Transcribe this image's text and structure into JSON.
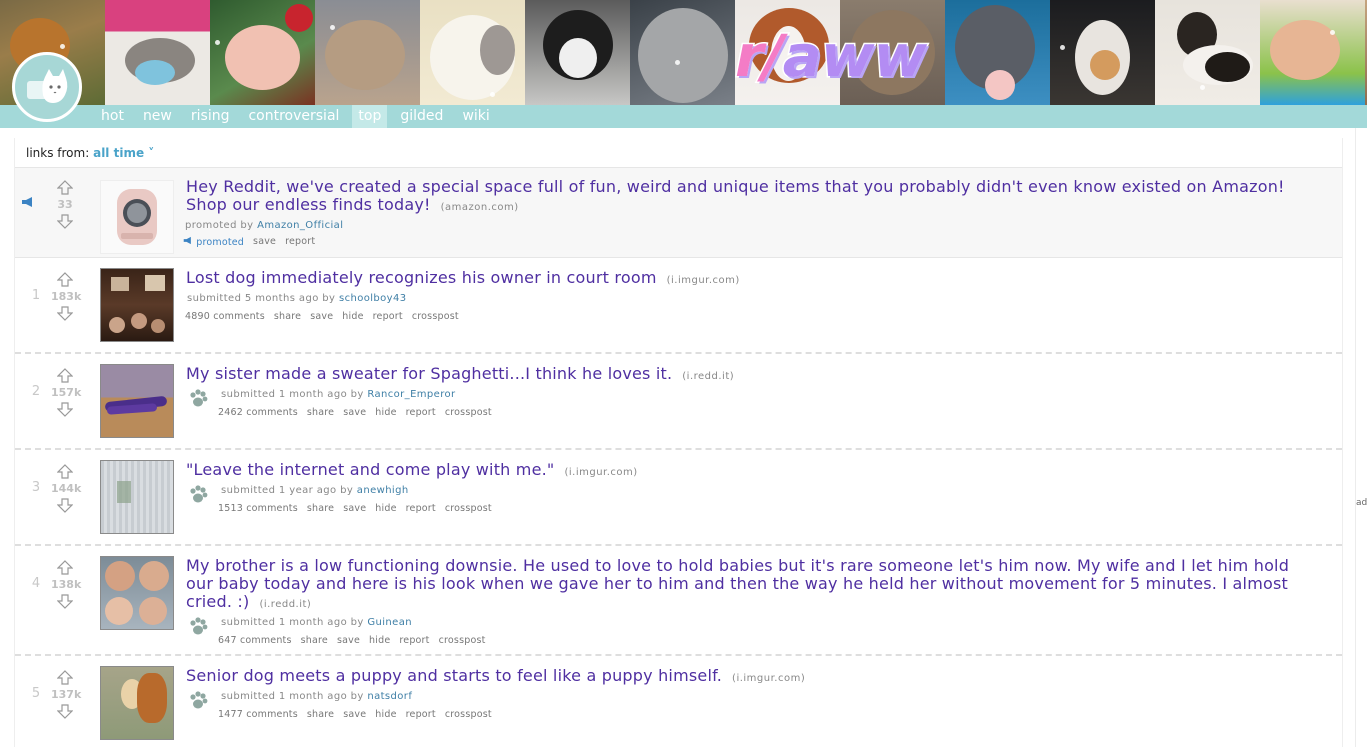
{
  "banner": {
    "logo": "r/aww"
  },
  "nav": {
    "tabs": [
      "hot",
      "new",
      "rising",
      "controversial",
      "top",
      "gilded",
      "wiki"
    ],
    "active": "top"
  },
  "filter": {
    "label": "links from:",
    "value": "all time ˅"
  },
  "promo": {
    "score": "33",
    "title": "Hey Reddit, we've created a special space full of fun, weird and unique items that you probably didn't even know existed on Amazon! Shop our endless finds today!",
    "domain": "(amazon.com)",
    "tag_prefix": "promoted by",
    "author": "Amazon_Official",
    "buttons": [
      "promoted",
      "save",
      "report"
    ]
  },
  "posts": [
    {
      "rank": "1",
      "score": "183k",
      "title": "Lost dog immediately recognizes his owner in court room",
      "domain": "(i.imgur.com)",
      "tag_prefix": "submitted 5 months ago by",
      "author": "schoolboy43",
      "comments": "4890 comments",
      "buttons": [
        "share",
        "save",
        "hide",
        "report",
        "crosspost"
      ]
    },
    {
      "rank": "2",
      "score": "157k",
      "title": "My sister made a sweater for Spaghetti...I think he loves it.",
      "domain": "(i.redd.it)",
      "tag_prefix": "submitted 1 month ago by",
      "author": "Rancor_Emperor",
      "comments": "2462 comments",
      "buttons": [
        "share",
        "save",
        "hide",
        "report",
        "crosspost"
      ]
    },
    {
      "rank": "3",
      "score": "144k",
      "title": "\"Leave the internet and come play with me.\"",
      "domain": "(i.imgur.com)",
      "tag_prefix": "submitted 1 year ago by",
      "author": "anewhigh",
      "comments": "1513 comments",
      "buttons": [
        "share",
        "save",
        "hide",
        "report",
        "crosspost"
      ]
    },
    {
      "rank": "4",
      "score": "138k",
      "title": "My brother is a low functioning downsie. He used to love to hold babies but it's rare someone let's him now. My wife and I let him hold our baby today and here is his look when we gave her to him and then the way he held her without movement for 5 minutes. I almost cried. :)",
      "domain": "(i.redd.it)",
      "tag_prefix": "submitted 1 month ago by",
      "author": "Guinean",
      "comments": "647 comments",
      "buttons": [
        "share",
        "save",
        "hide",
        "report",
        "crosspost"
      ]
    },
    {
      "rank": "5",
      "score": "137k",
      "title": "Senior dog meets a puppy and starts to feel like a puppy himself.",
      "domain": "(i.imgur.com)",
      "tag_prefix": "submitted 1 month ago by",
      "author": "natsdorf",
      "comments": "1477 comments",
      "buttons": [
        "share",
        "save",
        "hide",
        "report",
        "crosspost"
      ]
    }
  ],
  "edge_text": "ad",
  "colors": {
    "tabbar": "#a3d9d9",
    "title": "#4f2fa1",
    "author": "#3f7fa6",
    "filter_value": "#4aa3c9"
  }
}
